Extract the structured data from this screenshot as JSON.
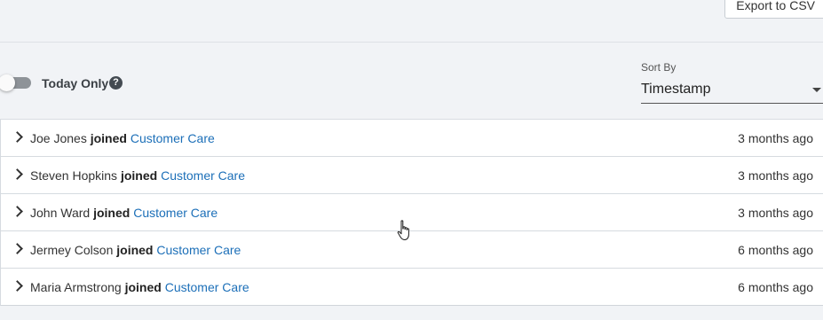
{
  "toolbar": {
    "export_label": "Export to CSV"
  },
  "filters": {
    "today_only_label": "Today Only",
    "today_only_on": false,
    "help_glyph": "?",
    "sort_by_label": "Sort By",
    "sort_by_value": "Timestamp"
  },
  "activity": {
    "rows": [
      {
        "name": "Joe Jones",
        "verb": "joined",
        "team": "Customer Care",
        "time": "3 months ago"
      },
      {
        "name": "Steven Hopkins",
        "verb": "joined",
        "team": "Customer Care",
        "time": "3 months ago"
      },
      {
        "name": "John Ward",
        "verb": "joined",
        "team": "Customer Care",
        "time": "3 months ago"
      },
      {
        "name": "Jermey Colson",
        "verb": "joined",
        "team": "Customer Care",
        "time": "6 months ago"
      },
      {
        "name": "Maria Armstrong",
        "verb": "joined",
        "team": "Customer Care",
        "time": "6 months ago"
      }
    ]
  },
  "colors": {
    "link": "#1c6fb8",
    "background": "#f1f3f6"
  },
  "icons": {
    "help": "help-icon",
    "expand": "chevron-right-icon",
    "dropdown": "caret-down-icon",
    "cursor": "hand-pointer-icon"
  }
}
